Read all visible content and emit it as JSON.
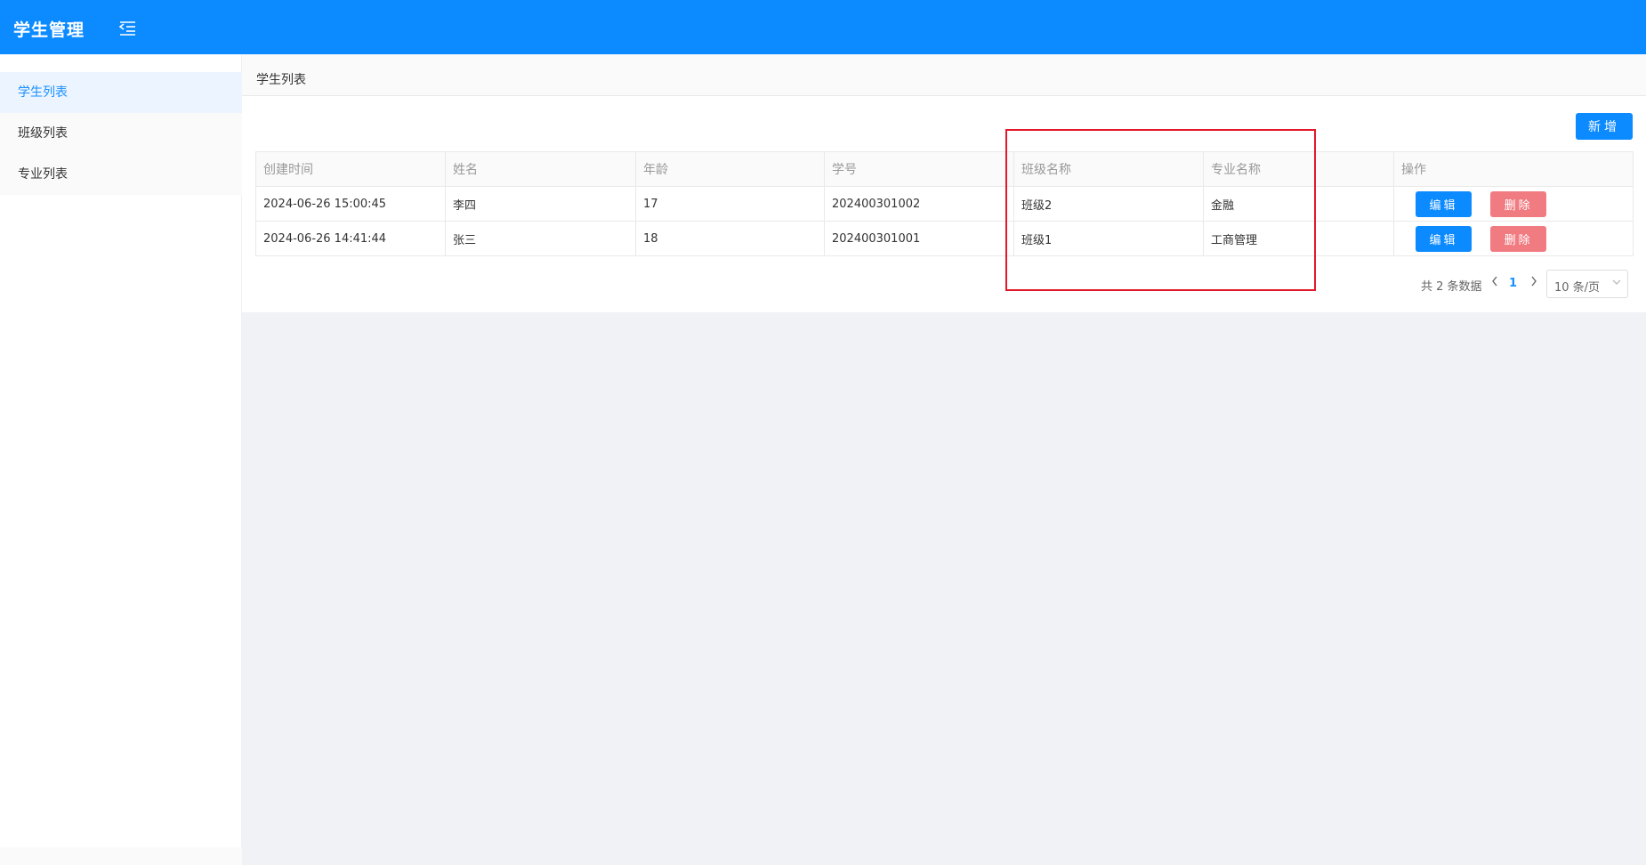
{
  "header": {
    "title": "学生管理",
    "menu_icon": "menu-fold-icon"
  },
  "sidebar": {
    "items": [
      {
        "label": "学生列表",
        "active": true
      },
      {
        "label": "班级列表",
        "active": false
      },
      {
        "label": "专业列表",
        "active": false
      }
    ]
  },
  "breadcrumb": "学生列表",
  "toolbar": {
    "add_label": "新增"
  },
  "table": {
    "columns": [
      "创建时间",
      "姓名",
      "年龄",
      "学号",
      "班级名称",
      "专业名称",
      "操作"
    ],
    "rows": [
      {
        "created": "2024-06-26 15:00:45",
        "name": "李四",
        "age": "17",
        "student_id": "202400301002",
        "class_name": "班级2",
        "major": "金融"
      },
      {
        "created": "2024-06-26 14:41:44",
        "name": "张三",
        "age": "18",
        "student_id": "202400301001",
        "class_name": "班级1",
        "major": "工商管理"
      }
    ],
    "edit_label": "编辑",
    "delete_label": "删除"
  },
  "pagination": {
    "total_text": "共 2 条数据",
    "current_page": "1",
    "page_size_label": "10 条/页"
  },
  "colors": {
    "primary": "#0c8aff",
    "danger": "#f07c82",
    "highlight": "#e3182a"
  }
}
